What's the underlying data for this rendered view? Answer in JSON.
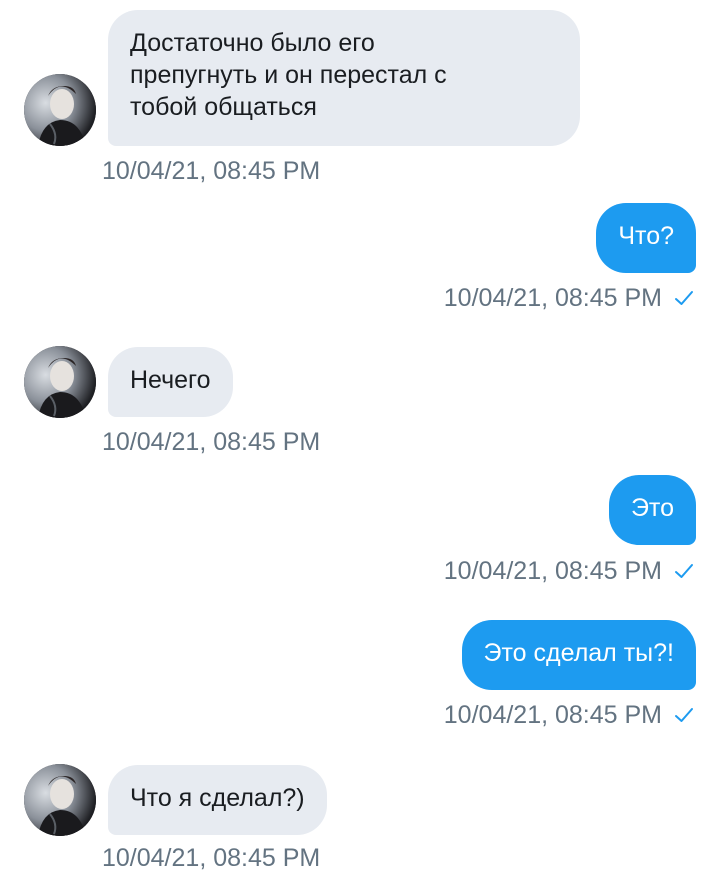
{
  "conversation": {
    "messages": [
      {
        "direction": "incoming",
        "text": "Достаточно было его препугнуть и он перестал с тобой общаться",
        "lines": [
          "Достаточно было его",
          "препугнуть и он перестал с",
          "тобой общаться"
        ],
        "time": "10/04/21, 08:45 PM"
      },
      {
        "direction": "outgoing",
        "text": "Что?",
        "time": "10/04/21, 08:45 PM",
        "read_icon": "check-icon"
      },
      {
        "direction": "incoming",
        "text": "Нечего",
        "time": "10/04/21, 08:45 PM"
      },
      {
        "direction": "outgoing",
        "text": "Это",
        "time": "10/04/21, 08:45 PM",
        "read_icon": "check-icon"
      },
      {
        "direction": "outgoing",
        "text": "Это сделал ты?!",
        "time": "10/04/21, 08:45 PM",
        "read_icon": "check-icon"
      },
      {
        "direction": "incoming",
        "text": "Что я сделал?)",
        "time": "10/04/21, 08:45 PM"
      }
    ]
  },
  "colors": {
    "incoming_bubble": "#e7ebf1",
    "outgoing_bubble": "#1d9bf0",
    "timestamp": "#637381",
    "read_check": "#1d9bf0"
  }
}
